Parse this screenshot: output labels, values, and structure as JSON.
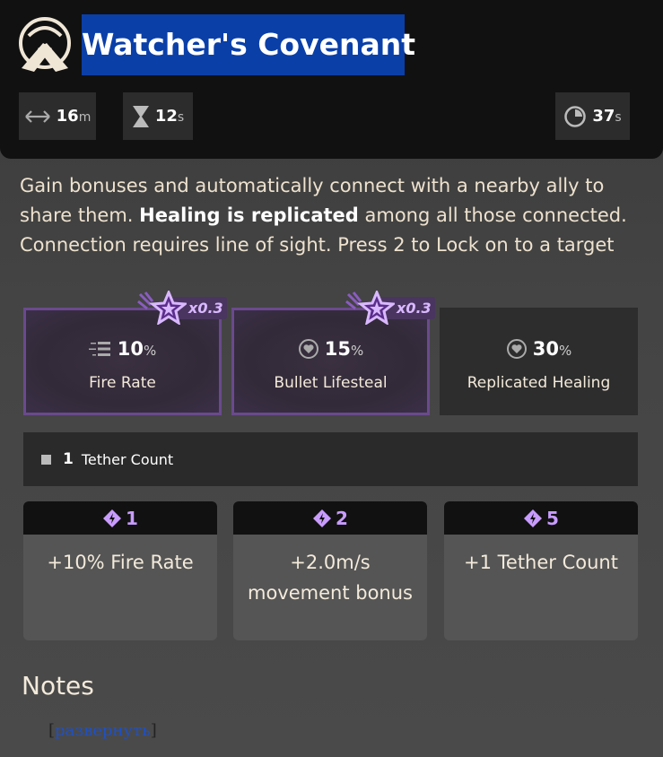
{
  "ability": {
    "title": "Watcher's Covenant",
    "icon": "tether-hands-icon"
  },
  "stats": {
    "range_value": "16",
    "range_unit": "m",
    "duration_value": "12",
    "duration_unit": "s",
    "cooldown_value": "37",
    "cooldown_unit": "s"
  },
  "description": {
    "part1": "Gain bonuses and automatically connect with a nearby ally to share them. ",
    "bold": "Healing is replicated",
    "part2": " among all those connected. Connection requires line of sight. Press 2 to Lock on to a target"
  },
  "cards": [
    {
      "value": "10",
      "unit": "%",
      "label": "Fire Rate",
      "multiplier": "x0.3",
      "icon": "fire-rate-icon"
    },
    {
      "value": "15",
      "unit": "%",
      "label": "Bullet Lifesteal",
      "multiplier": "x0.3",
      "icon": "heart-icon"
    },
    {
      "value": "30",
      "unit": "%",
      "label": "Replicated Healing",
      "icon": "heart-icon"
    }
  ],
  "tether": {
    "value": "1",
    "label": "Tether Count"
  },
  "tiers": [
    {
      "points": "1",
      "line1": "+10% Fire Rate",
      "line2": ""
    },
    {
      "points": "2",
      "line1": "+2.0m/s",
      "line2": "movement bonus"
    },
    {
      "points": "5",
      "line1": "+1 Tether Count",
      "line2": ""
    }
  ],
  "notes": {
    "title": "Notes",
    "expand_label": "развернуть",
    "bracket_open": "[",
    "bracket_close": "]"
  },
  "colors": {
    "title_highlight": "#0a3fa8",
    "boost_border": "#6a4a8c",
    "tier_accent": "#c89cff"
  }
}
